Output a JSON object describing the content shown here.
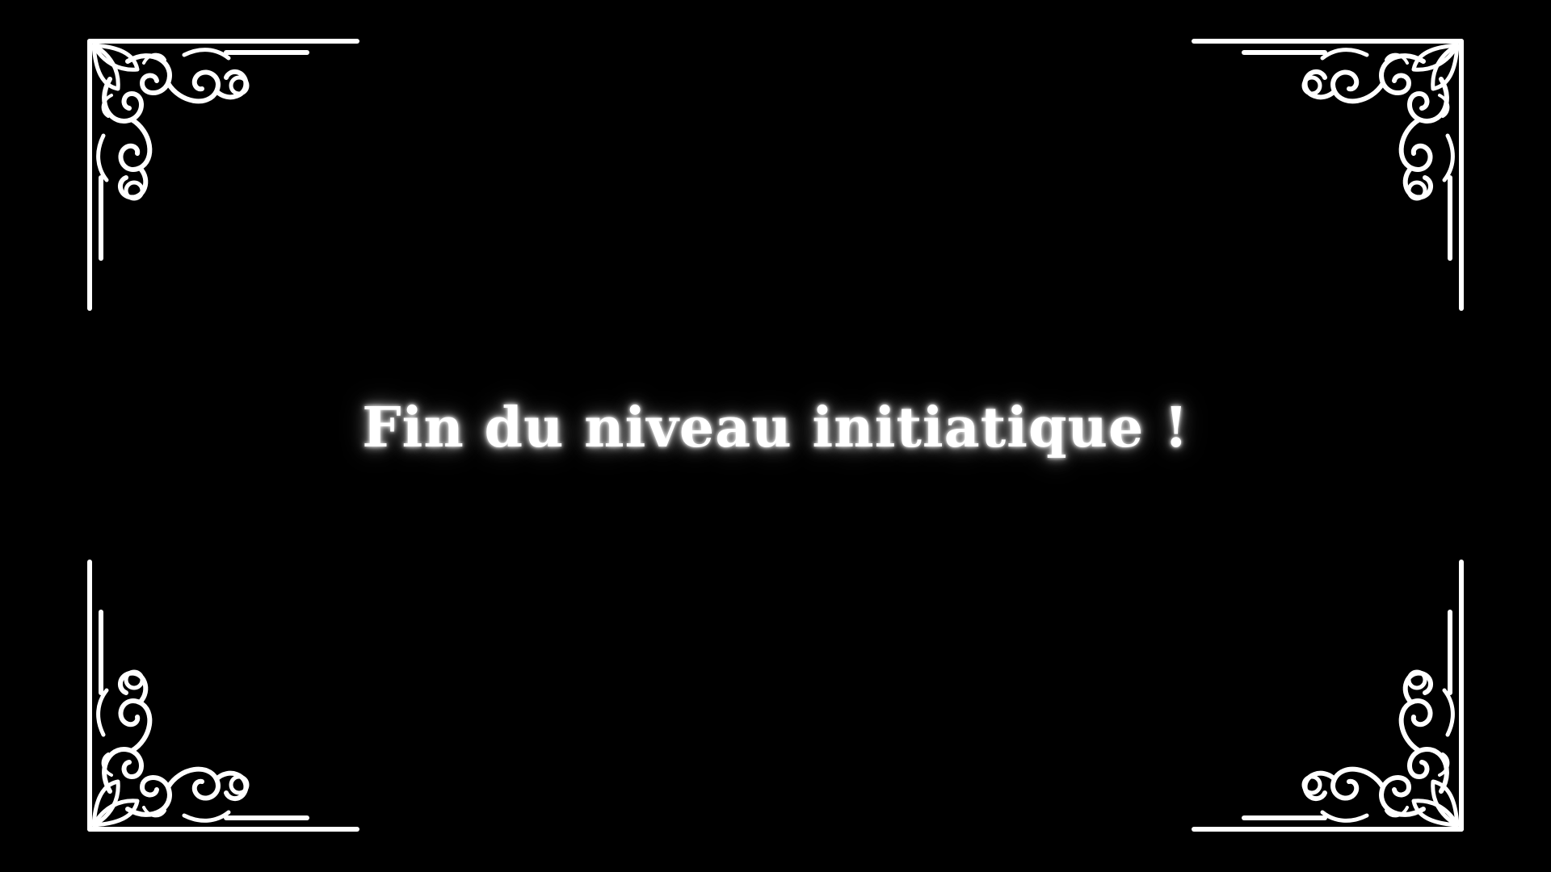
{
  "screen": {
    "message": "Fin du niveau initiatique !",
    "background_color": "#000000",
    "ornament_color": "#ffffff",
    "frame_style": "silent-film ornate corners"
  },
  "ornaments": {
    "top_left": "ornate-corner-icon",
    "top_right": "ornate-corner-icon",
    "bottom_left": "ornate-corner-icon",
    "bottom_right": "ornate-corner-icon"
  }
}
